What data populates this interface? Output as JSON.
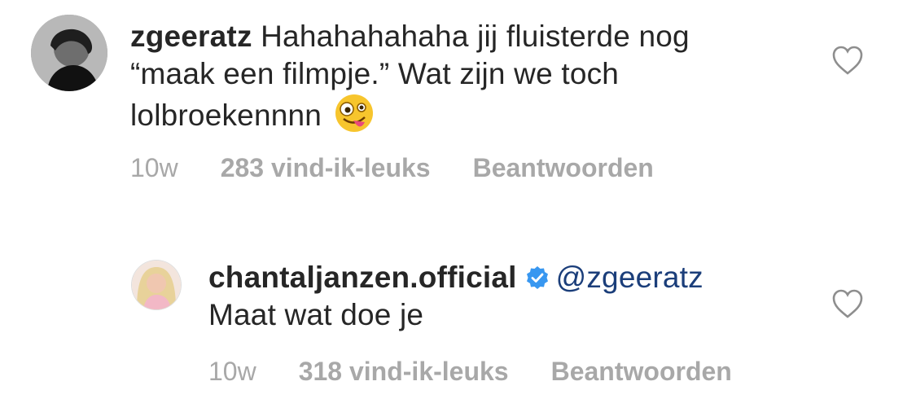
{
  "comments": [
    {
      "username": "zgeeratz",
      "text_lines": [
        "Hahahahahaha jij fluisterde nog",
        "“maak een filmpje.” Wat zijn we toch",
        "lolbroekennnn"
      ],
      "emoji_icon": "zany-face-emoji",
      "time": "10w",
      "likes": "283 vind-ik-leuks",
      "reply": "Beantwoorden"
    },
    {
      "username": "chantaljanzen.official",
      "verified": true,
      "mention": "@zgeeratz",
      "text": "Maat wat doe je",
      "time": "10w",
      "likes": "318 vind-ik-leuks",
      "reply": "Beantwoorden"
    }
  ],
  "colors": {
    "text": "#262626",
    "meta": "#a8a8a8",
    "mention": "#1b3e7a",
    "verified": "#3897f0",
    "heart_outline": "#8e8e8e"
  }
}
